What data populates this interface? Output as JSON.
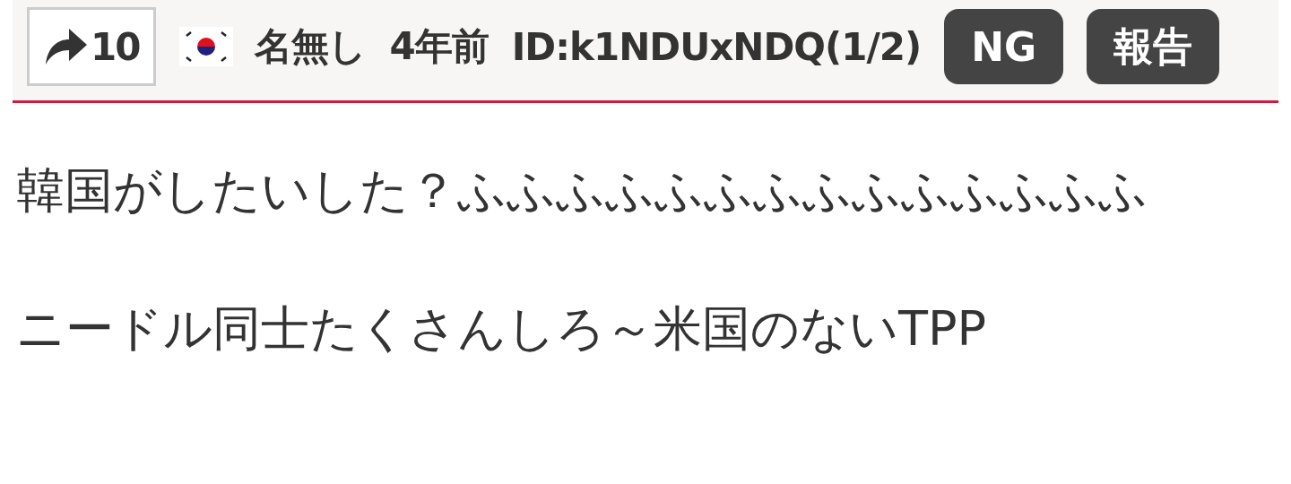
{
  "post": {
    "share_count": "10",
    "author": "名無し",
    "time": "4年前",
    "id": "ID:k1NDUxNDQ(1/2)",
    "ng_button": "NG",
    "report_button": "報告",
    "body": [
      "韓国がしたいした？ふふふふふふふふふふふふふふ",
      "ニードル同士たくさんしろ～米国のないTPP"
    ]
  }
}
